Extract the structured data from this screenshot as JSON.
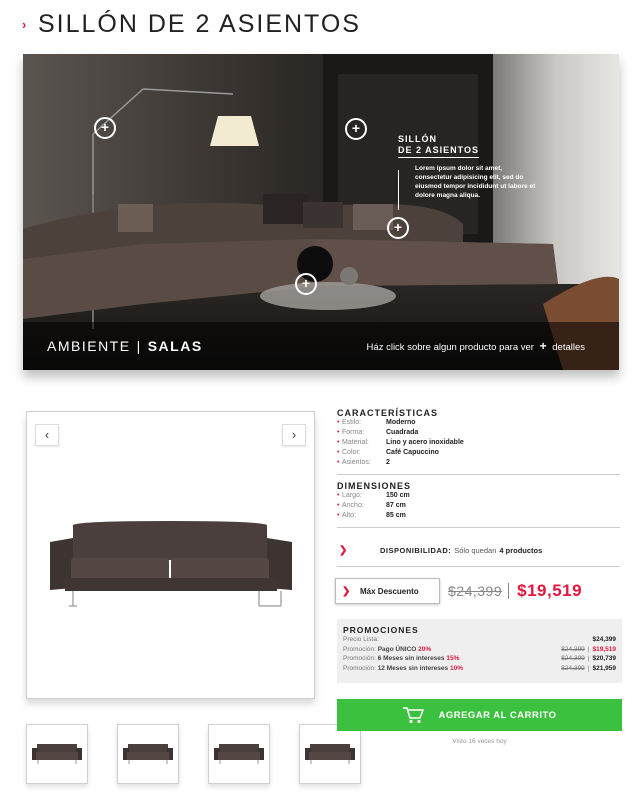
{
  "page": {
    "title": "SILLÓN DE 2 ASIENTOS"
  },
  "hero": {
    "callout_title_1": "SILLÓN",
    "callout_title_2": "DE 2 ASIENTOS",
    "callout_text": "Lorem ipsum dolor sit amet, consectetur adipisicing elit, sed do eiusmod tempor incididunt ut labore et dolore magna aliqua.",
    "ambiente_label": "AMBIENTE",
    "separator": "|",
    "ambiente_value": "SALAS",
    "hint_before": "Ház click sobre algun producto para ver",
    "hint_plus": "+",
    "hint_after": "detalles",
    "hotspot_icon": "plus-circle-icon"
  },
  "gallery": {
    "prev_icon": "‹",
    "next_icon": "›"
  },
  "caracteristicas": {
    "title": "CARACTERÍSTICAS",
    "items": [
      {
        "key": "Estilo:",
        "value": "Moderno"
      },
      {
        "key": "Forma:",
        "value": "Cuadrada"
      },
      {
        "key": "Material:",
        "value": "Lino y acero inoxidable"
      },
      {
        "key": "Color:",
        "value": "Café Capuccino"
      },
      {
        "key": "Asientos:",
        "value": "2"
      }
    ]
  },
  "dimensiones": {
    "title": "DIMENSIONES",
    "items": [
      {
        "key": "Largo:",
        "value": "150 cm"
      },
      {
        "key": "Ancho:",
        "value": "87 cm"
      },
      {
        "key": "Alto:",
        "value": "85 cm"
      }
    ]
  },
  "disponibilidad": {
    "label": "DISPONIBILIDAD:",
    "text": "Sólo quedan",
    "count": "4 productos"
  },
  "price": {
    "descuento_label": "Máx Descuento",
    "old": "$24,399",
    "separator": "|",
    "new": "$19,519"
  },
  "promociones": {
    "title": "PROMOCIONES",
    "lista_label": "Precio Lista:",
    "lista_price": "$24,399",
    "rows": [
      {
        "prefix": "Promoción:",
        "label": "Pago ÚNICO",
        "pct": "20%",
        "old": "$24,399",
        "sep": "|",
        "now": "$19,519"
      },
      {
        "prefix": "Promoción:",
        "label": "6 Meses sin intereses",
        "pct": "15%",
        "old": "$24,399",
        "sep": "|",
        "now": "$20,739"
      },
      {
        "prefix": "Promoción:",
        "label": "12 Meses sin intereses",
        "pct": "10%",
        "old": "$24,399",
        "sep": "|",
        "now": "$21,959"
      }
    ]
  },
  "cart": {
    "label": "AGREGAR AL CARRITO",
    "icon": "cart-icon"
  },
  "views": {
    "text": "Visto 16 veces hoy"
  },
  "colors": {
    "accent": "#e4173e",
    "cart": "#3bc13f",
    "sofa": "#4a3f3c"
  }
}
